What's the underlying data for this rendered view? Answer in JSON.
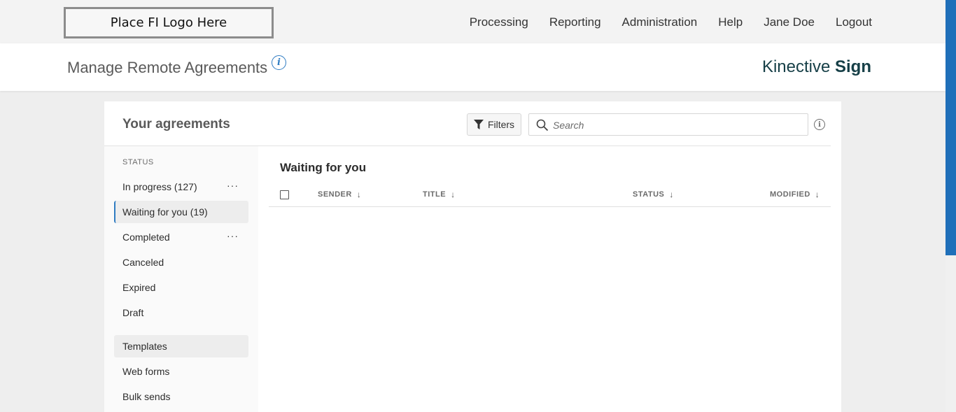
{
  "topbar": {
    "logo_text": "Place FI Logo Here",
    "nav": [
      "Processing",
      "Reporting",
      "Administration",
      "Help",
      "Jane Doe",
      "Logout"
    ]
  },
  "header": {
    "title": "Manage Remote Agreements",
    "info_glyph": "i",
    "brand_light": "Kinective",
    "brand_bold": "Sign"
  },
  "card": {
    "title": "Your agreements",
    "filters_label": "Filters",
    "search_placeholder": "Search"
  },
  "sidebar": {
    "status_label": "STATUS",
    "items": [
      {
        "label": "In progress (127)",
        "has_menu": true
      },
      {
        "label": "Waiting for you (19)",
        "active": true
      },
      {
        "label": "Completed",
        "has_menu": true
      },
      {
        "label": "Canceled"
      },
      {
        "label": "Expired"
      },
      {
        "label": "Draft"
      },
      {
        "label": "Templates",
        "shaded": true
      },
      {
        "label": "Web forms"
      },
      {
        "label": "Bulk sends"
      }
    ],
    "menu_glyph": "···"
  },
  "list": {
    "title": "Waiting for you",
    "columns": [
      "SENDER",
      "TITLE",
      "STATUS",
      "MODIFIED"
    ],
    "sort_glyph": "↓"
  },
  "colors": {
    "accent": "#2f7cc2",
    "brand": "#163f47",
    "scrollbar": "#1f6fb9"
  },
  "icons": [
    "info-icon",
    "filter-icon",
    "search-icon",
    "more-icon",
    "sort-down-icon",
    "checkbox-icon"
  ]
}
